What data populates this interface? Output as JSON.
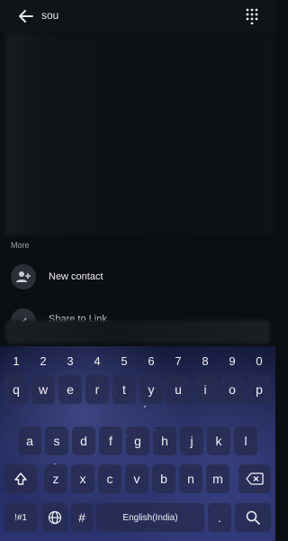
{
  "search": {
    "query": "sou"
  },
  "icons": {
    "back": "arrow-left-icon",
    "dialpad": "dialpad-icon",
    "new_contact": "person-add-icon"
  },
  "more_section": {
    "label": "More",
    "items": [
      {
        "label": "New contact"
      },
      {
        "label": "Share to Link"
      }
    ]
  },
  "keyboard": {
    "numbers": [
      "1",
      "2",
      "3",
      "4",
      "5",
      "6",
      "7",
      "8",
      "9",
      "0"
    ],
    "row1": [
      "q",
      "w",
      "e",
      "r",
      "t",
      "y",
      "u",
      "i",
      "o",
      "p"
    ],
    "row2": [
      "a",
      "s",
      "d",
      "f",
      "g",
      "h",
      "j",
      "k",
      "l"
    ],
    "row3": [
      "z",
      "x",
      "c",
      "v",
      "b",
      "n",
      "m"
    ],
    "symbols_label": "!#1",
    "hash_label": "#",
    "space_label": "English(India)",
    "period_label": ".",
    "colors": {
      "key_bg": "#2a2e55",
      "key_text": "#f2f3f8"
    }
  }
}
